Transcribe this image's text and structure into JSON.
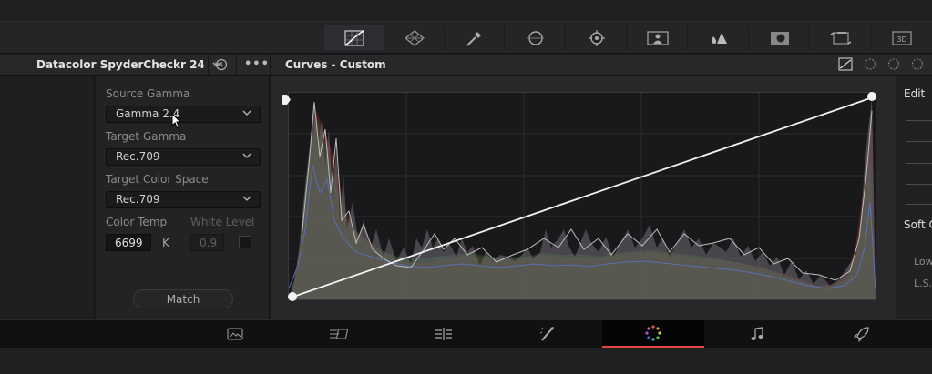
{
  "toolbar": {
    "tools": [
      {
        "name": "curves-icon"
      },
      {
        "name": "warper-icon"
      },
      {
        "name": "qualifier-icon"
      },
      {
        "name": "window-icon"
      },
      {
        "name": "tracker-icon"
      },
      {
        "name": "magic-mask-icon"
      },
      {
        "name": "blur-icon"
      },
      {
        "name": "key-icon"
      },
      {
        "name": "sizing-icon"
      },
      {
        "name": "3d-icon",
        "label": "3D"
      }
    ]
  },
  "header": {
    "chart_name": "Datacolor SpyderCheckr 24",
    "panel_title": "Curves - Custom"
  },
  "settings": {
    "source_gamma_label": "Source Gamma",
    "source_gamma_value": "Gamma 2.4",
    "target_gamma_label": "Target Gamma",
    "target_gamma_value": "Rec.709",
    "target_color_space_label": "Target Color Space",
    "target_color_space_value": "Rec.709",
    "color_temp_label": "Color Temp",
    "color_temp_value": "6699",
    "color_temp_unit": "K",
    "white_level_label": "White Level",
    "white_level_value": "0.9",
    "match_label": "Match"
  },
  "right_panel": {
    "edit_label": "Edit",
    "soft_clip_label": "Soft C",
    "low_label": "Low",
    "ls_label": "L.S."
  },
  "pages": [
    {
      "name": "media-page-icon"
    },
    {
      "name": "cut-page-icon"
    },
    {
      "name": "edit-page-icon"
    },
    {
      "name": "fusion-page-icon"
    },
    {
      "name": "color-page-icon",
      "active": true
    },
    {
      "name": "fairlight-page-icon"
    },
    {
      "name": "deliver-page-icon"
    }
  ],
  "colors": {
    "accent_red": "#e0463a",
    "curve_white": "#f0f0f0",
    "panel_bg": "#28282b"
  }
}
